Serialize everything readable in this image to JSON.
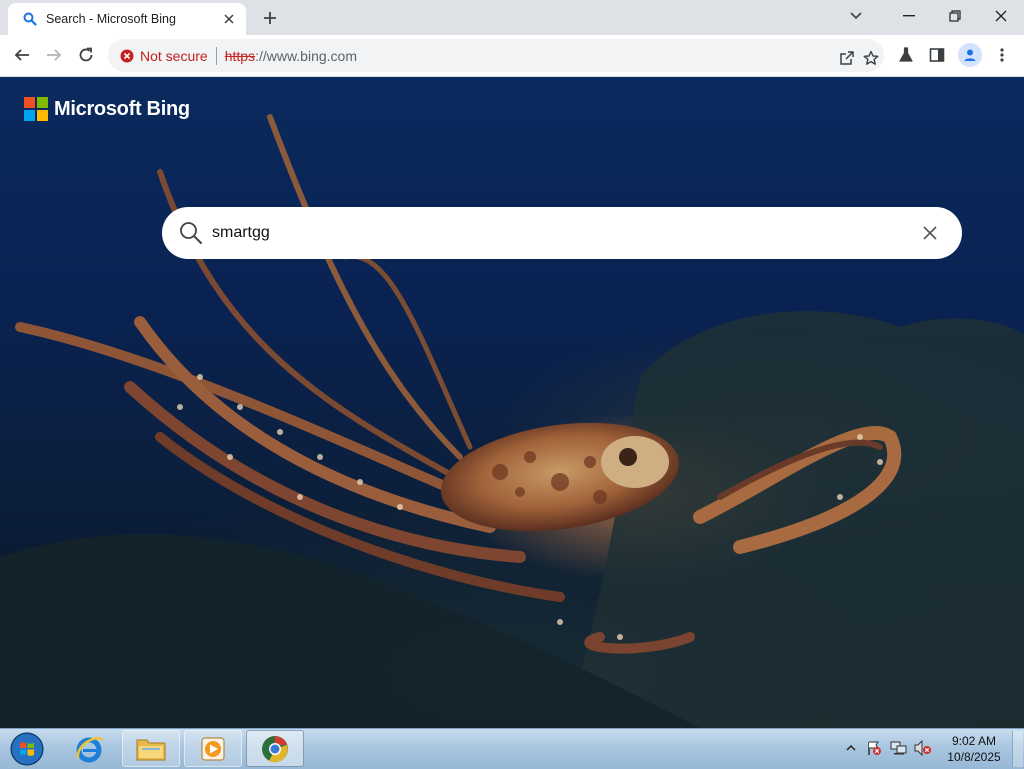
{
  "browser": {
    "tab": {
      "title": "Search - Microsoft Bing"
    },
    "security_label": "Not secure",
    "url_scheme": "https",
    "url_rest": "://www.bing.com"
  },
  "page": {
    "brand": "Microsoft Bing",
    "search": {
      "value": "smartgg"
    }
  },
  "taskbar": {
    "time": "9:02 AM",
    "date": "10/8/2025"
  },
  "colors": {
    "bing_red": "#f25022",
    "bing_green": "#7fba00",
    "bing_blue": "#00a4ef",
    "bing_yellow": "#ffb900",
    "insecure_red": "#c5221f"
  }
}
